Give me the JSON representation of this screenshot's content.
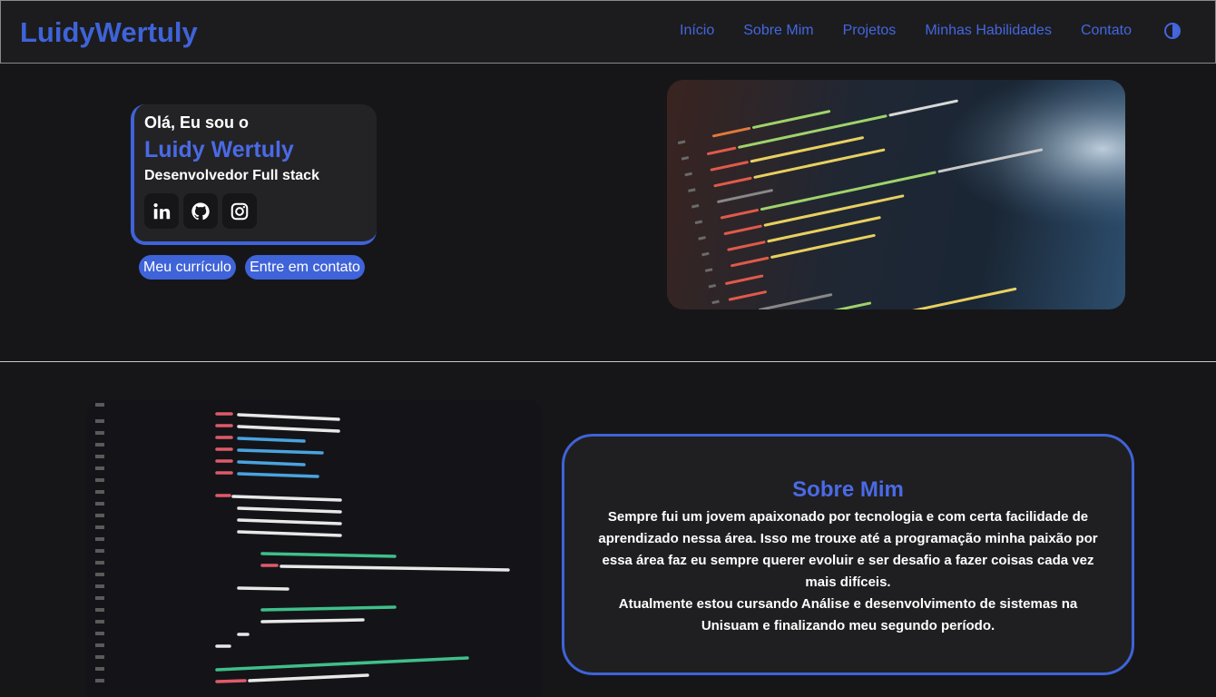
{
  "header": {
    "logo": "LuidyWertuly",
    "nav": [
      "Início",
      "Sobre Mim",
      "Projetos",
      "Minhas Habilidades",
      "Contato"
    ],
    "theme_icon": "contrast-icon"
  },
  "hero": {
    "greeting": "Olá, Eu sou o",
    "name": "Luidy Wertuly",
    "role": "Desenvolvedor Full stack",
    "social_icons": [
      "linkedin-icon",
      "github-icon",
      "instagram-icon"
    ],
    "btn_cv": "Meu currículo",
    "btn_contact": "Entre em contato"
  },
  "about": {
    "title": "Sobre Mim",
    "p1": "Sempre fui um jovem apaixonado por tecnologia e com certa facilidade de aprendizado nessa área. Isso me trouxe até a programação minha paixão por essa área faz eu sempre querer evoluir e ser desafio a fazer coisas cada vez mais difíceis.",
    "p2": "Atualmente estou cursando Análise e desenvolvimento de sistemas na Unisuam e finalizando meu segundo período."
  },
  "colors": {
    "accent": "#3f63d8",
    "background": "#161618",
    "card": "#232325"
  }
}
